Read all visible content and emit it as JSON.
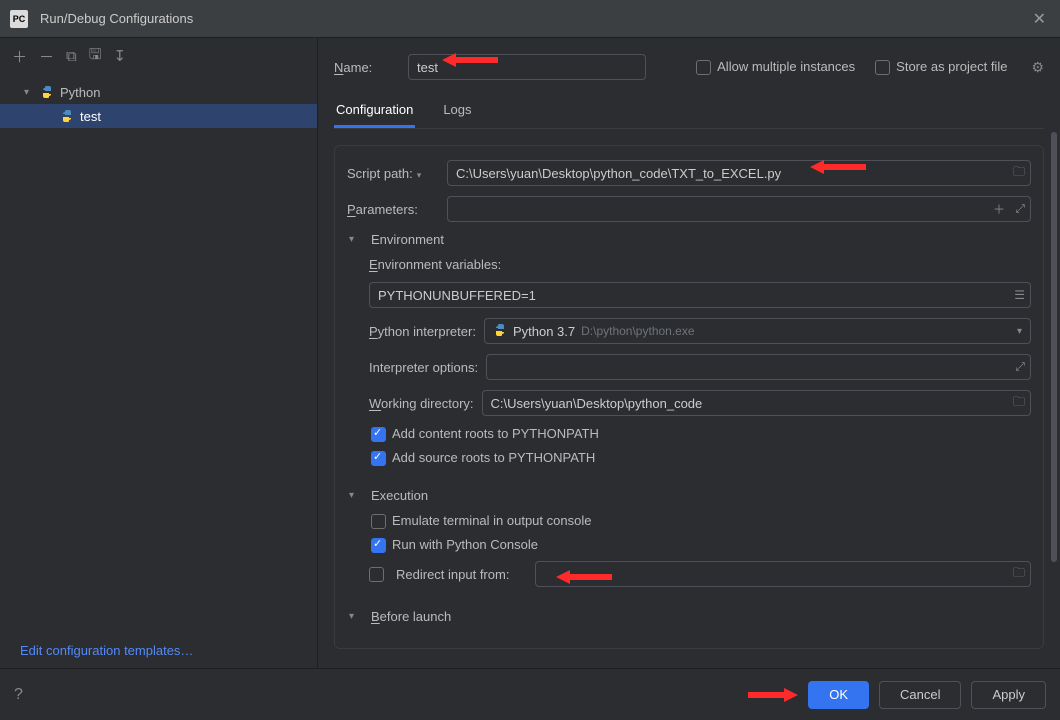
{
  "window": {
    "title": "Run/Debug Configurations"
  },
  "sidebar": {
    "items": [
      {
        "label": "Python",
        "expanded": true,
        "children": [
          {
            "label": "test"
          }
        ]
      }
    ],
    "templates_link": "Edit configuration templates…"
  },
  "header": {
    "name_label": "Name:",
    "name_value": "test",
    "allow_multiple": "Allow multiple instances",
    "store_project": "Store as project file"
  },
  "tabs": [
    {
      "label": "Configuration",
      "active": true
    },
    {
      "label": "Logs",
      "active": false
    }
  ],
  "form": {
    "script_path_label": "Script path:",
    "script_path_value": "C:\\Users\\yuan\\Desktop\\python_code\\TXT_to_EXCEL.py",
    "parameters_label": "Parameters:",
    "parameters_value": "",
    "environment_section": "Environment",
    "env_vars_label": "Environment variables:",
    "env_vars_value": "PYTHONUNBUFFERED=1",
    "interpreter_label": "Python interpreter:",
    "interpreter_name": "Python 3.7",
    "interpreter_path": "D:\\python\\python.exe",
    "interpreter_opts_label": "Interpreter options:",
    "interpreter_opts_value": "",
    "working_dir_label": "Working directory:",
    "working_dir_value": "C:\\Users\\yuan\\Desktop\\python_code",
    "add_content_roots": "Add content roots to PYTHONPATH",
    "add_source_roots": "Add source roots to PYTHONPATH",
    "execution_section": "Execution",
    "emulate_terminal": "Emulate terminal in output console",
    "run_python_console": "Run with Python Console",
    "redirect_input": "Redirect input from:",
    "redirect_input_value": "",
    "before_launch_section": "Before launch"
  },
  "buttons": {
    "ok": "OK",
    "cancel": "Cancel",
    "apply": "Apply"
  }
}
